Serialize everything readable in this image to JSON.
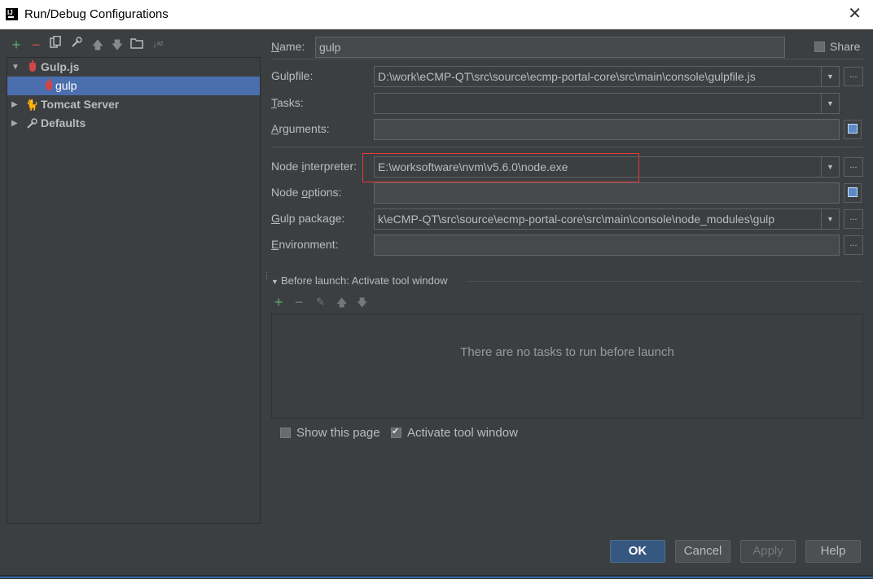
{
  "window": {
    "title": "Run/Debug Configurations"
  },
  "tree": {
    "items": [
      {
        "label": "Gulp.js",
        "icon": "gulp-icon",
        "expanded": true
      },
      {
        "label": "gulp",
        "icon": "gulp-icon",
        "selected": true
      },
      {
        "label": "Tomcat Server",
        "icon": "tomcat-icon",
        "expanded": false
      },
      {
        "label": "Defaults",
        "icon": "wrench-icon",
        "expanded": false
      }
    ]
  },
  "form": {
    "name_label": "Name:",
    "name_value": "gulp",
    "share_label": "Share",
    "gulpfile_label": "Gulpfile:",
    "gulpfile_value": "D:\\work\\eCMP-QT\\src\\source\\ecmp-portal-core\\src\\main\\console\\gulpfile.js",
    "tasks_label": "Tasks:",
    "tasks_value": "",
    "arguments_label": "Arguments:",
    "arguments_value": "",
    "node_interpreter_label": "Node interpreter:",
    "node_interpreter_value": "E:\\worksoftware\\nvm\\v5.6.0\\node.exe",
    "node_options_label": "Node options:",
    "node_options_value": "",
    "gulp_package_label": "Gulp package:",
    "gulp_package_value": "k\\eCMP-QT\\src\\source\\ecmp-portal-core\\src\\main\\console\\node_modules\\gulp",
    "environment_label": "Environment:",
    "environment_value": "",
    "ellipsis": "..."
  },
  "before_launch": {
    "title": "Before launch: Activate tool window",
    "empty_message": "There are no tasks to run before launch",
    "show_this_page_label": "Show this page",
    "show_this_page_checked": false,
    "activate_tool_window_label": "Activate tool window",
    "activate_tool_window_checked": true
  },
  "buttons": {
    "ok": "OK",
    "cancel": "Cancel",
    "apply": "Apply",
    "help": "Help"
  },
  "colors": {
    "background": "#3c3f41",
    "selection": "#4b6eaf",
    "highlight": "#e33a3a",
    "ok_button": "#365880"
  }
}
